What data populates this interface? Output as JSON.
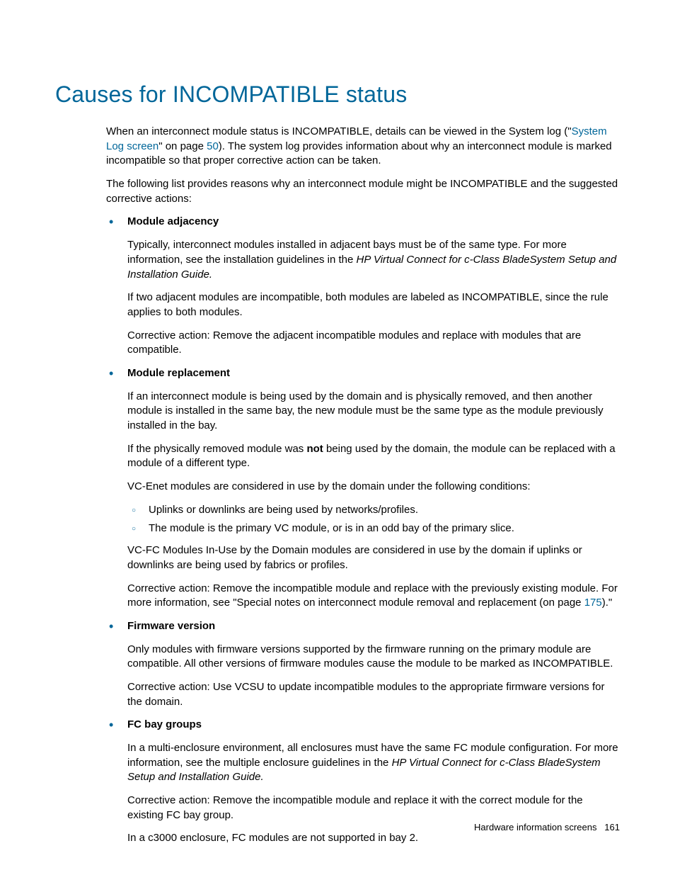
{
  "title": "Causes for INCOMPATIBLE status",
  "intro_p1_a": "When an interconnect module status is INCOMPATIBLE, details can be viewed in the System log (\"",
  "intro_p1_link1": "System Log screen",
  "intro_p1_b": "\" on page ",
  "intro_p1_link2": "50",
  "intro_p1_c": "). The system log provides information about why an interconnect module is marked incompatible so that proper corrective action can be taken.",
  "intro_p2": "The following list provides reasons why an interconnect module might be INCOMPATIBLE and the suggested corrective actions:",
  "items": [
    {
      "heading": "Module adjacency",
      "paras": [
        {
          "pre": "Typically, interconnect modules installed in adjacent bays must be of the same type. For more information, see the installation guidelines in the ",
          "italic": "HP Virtual Connect for c-Class BladeSystem Setup and Installation Guide.",
          "post": ""
        },
        {
          "text": "If two adjacent modules are incompatible, both modules are labeled as INCOMPATIBLE, since the rule applies to both modules."
        },
        {
          "text": "Corrective action: Remove the adjacent incompatible modules and replace with modules that are compatible."
        }
      ]
    },
    {
      "heading": "Module replacement",
      "paras": [
        {
          "text": "If an interconnect module is being used by the domain and is physically removed, and then another module is installed in the same bay, the new module must be the same type as the module previously installed in the bay."
        },
        {
          "pre": "If the physically removed module was ",
          "bold": "not",
          "post": " being used by the domain, the module can be replaced with a module of a different type."
        },
        {
          "text": "VC-Enet modules are considered in use by the domain under the following conditions:"
        }
      ],
      "sublist": [
        "Uplinks or downlinks are being used by networks/profiles.",
        "The module is the primary VC module, or is in an odd bay of the primary slice."
      ],
      "after_paras": [
        {
          "text": "VC-FC Modules In-Use by the Domain modules are considered in use by the domain if uplinks or downlinks are being used by fabrics or profiles."
        },
        {
          "pre": "Corrective action: Remove the incompatible module and replace with the previously existing module. For more information, see \"Special notes on interconnect module removal and replacement (on page ",
          "link": "175",
          "post": ").\""
        }
      ]
    },
    {
      "heading": "Firmware version",
      "paras": [
        {
          "text": "Only modules with firmware versions supported by the firmware running on the primary module are compatible. All other versions of firmware modules cause the module to be marked as INCOMPATIBLE."
        },
        {
          "text": "Corrective action: Use VCSU to update incompatible modules to the appropriate firmware versions for the domain."
        }
      ]
    },
    {
      "heading": "FC bay groups",
      "paras": [
        {
          "pre": "In a multi-enclosure environment, all enclosures must have the same FC module configuration. For more information, see the multiple enclosure guidelines in the ",
          "italic": "HP Virtual Connect for c-Class BladeSystem Setup and Installation Guide.",
          "post": ""
        },
        {
          "text": "Corrective action: Remove the incompatible module and replace it with the correct module for the existing FC bay group."
        },
        {
          "text": "In a c3000 enclosure, FC modules are not supported in bay 2."
        }
      ]
    }
  ],
  "footer_text": "Hardware information screens",
  "footer_page": "161"
}
